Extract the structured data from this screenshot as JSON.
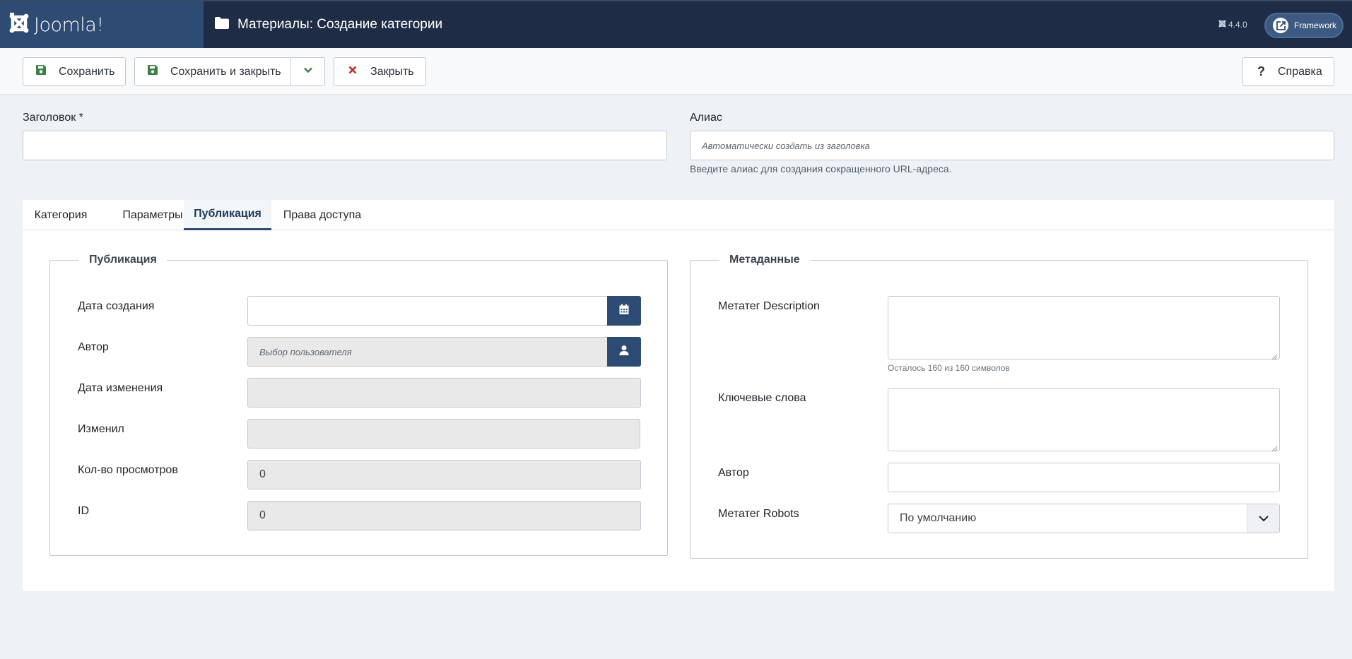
{
  "header": {
    "logo_text": "Joomla!",
    "page_title": "Материалы: Создание категории",
    "version": "4.4.0",
    "framework_label": "Framework",
    "colors": {
      "header_bg": "#1e2d45",
      "logo_bg": "#2d4b73",
      "accent": "#2d4b73"
    }
  },
  "toolbar": {
    "save_label": "Сохранить",
    "save_close_label": "Сохранить и закрыть",
    "close_label": "Закрыть",
    "help_label": "Справка",
    "help_icon": "?"
  },
  "form": {
    "title_label": "Заголовок *",
    "title_value": "",
    "alias_label": "Алиас",
    "alias_placeholder": "Автоматически создать из заголовка",
    "alias_hint": "Введите алиас для создания сокращенного URL-адреса."
  },
  "tabs": [
    {
      "label": "Категория",
      "active": false
    },
    {
      "label": "Параметры",
      "active": false
    },
    {
      "label": "Публикация",
      "active": true
    },
    {
      "label": "Права доступа",
      "active": false
    }
  ],
  "publication": {
    "legend": "Публикация",
    "created_label": "Дата создания",
    "created_value": "",
    "author_label": "Автор",
    "author_placeholder": "Выбор пользователя",
    "modified_label": "Дата изменения",
    "modified_value": "",
    "modified_by_label": "Изменил",
    "modified_by_value": "",
    "hits_label": "Кол-во просмотров",
    "hits_value": "0",
    "id_label": "ID",
    "id_value": "0"
  },
  "metadata": {
    "legend": "Метаданные",
    "description_label": "Метатег Description",
    "description_counter": "Осталось 160 из 160 символов",
    "keywords_label": "Ключевые слова",
    "author_label": "Автор",
    "author_value": "",
    "robots_label": "Метатег Robots",
    "robots_value": "По умолчанию"
  }
}
